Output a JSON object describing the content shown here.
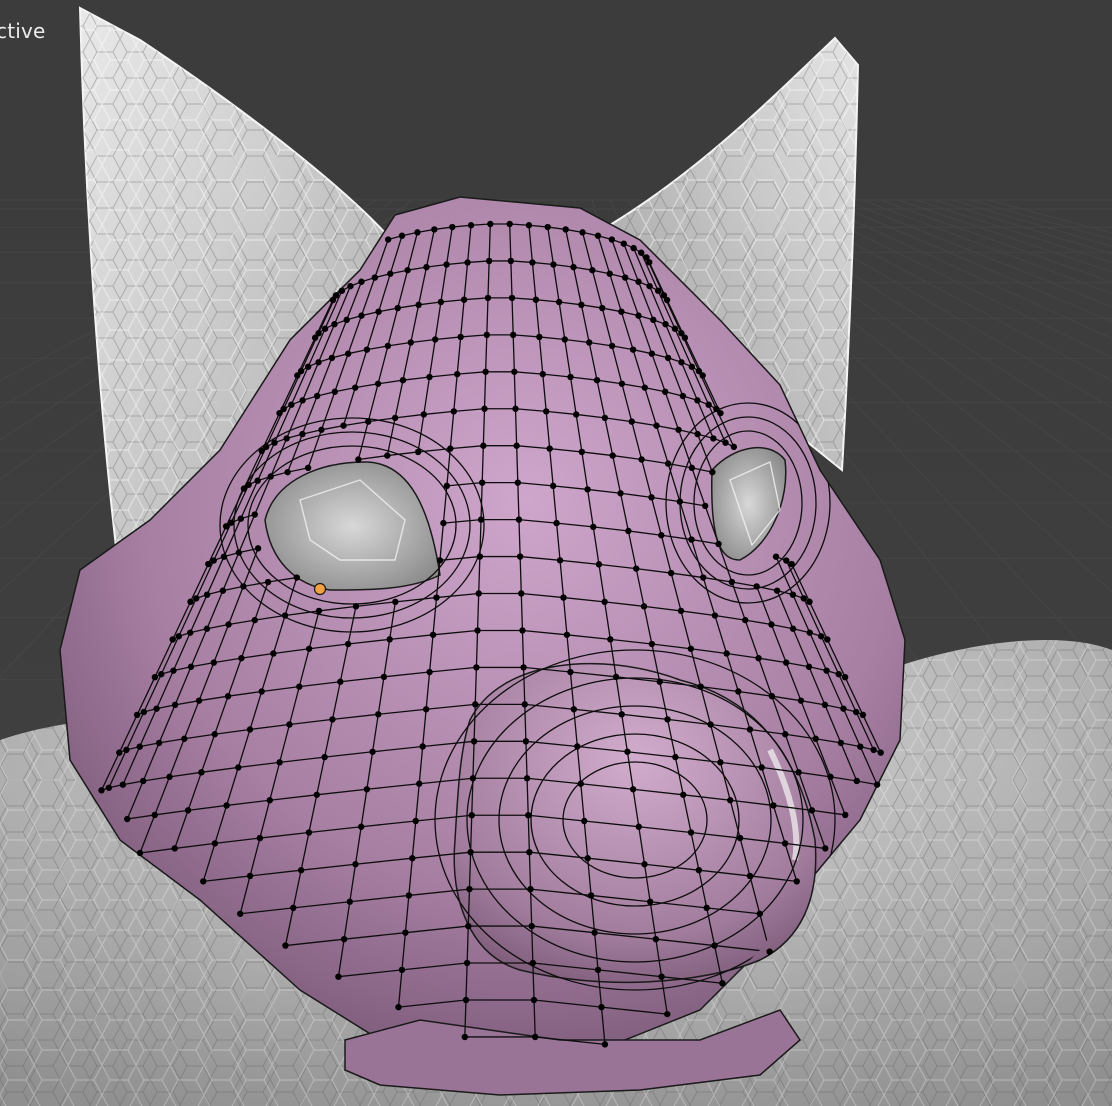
{
  "viewport": {
    "mode_label": "ctive"
  },
  "scene": {
    "base_mesh_color": "#d6d6d6",
    "edit_mesh_color": "#b98fb4",
    "edge_color": "#000000",
    "vertex_color": "#000000",
    "active_vertex_color": "#f3a040",
    "background_color": "#3d3d3d",
    "grid_color": "#4a4a4a"
  }
}
